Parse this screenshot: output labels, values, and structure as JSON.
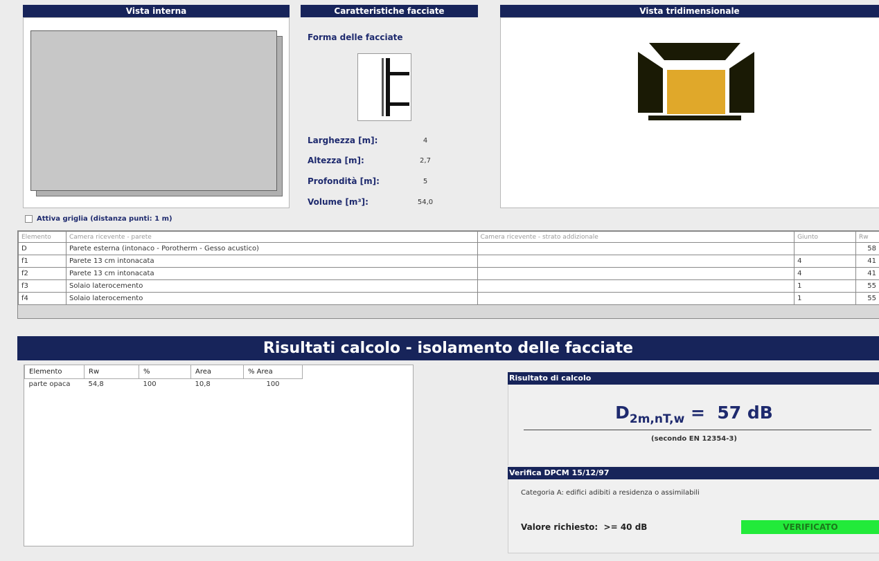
{
  "panels": {
    "internal_view": "Vista interna",
    "facade_features": "Caratteristiche facciate",
    "view_3d": "Vista tridimensionale"
  },
  "facade": {
    "shape_label": "Forma delle facciate",
    "width_label": "Larghezza [m]:",
    "width_value": "4",
    "height_label": "Altezza [m]:",
    "height_value": "2,7",
    "depth_label": "Profondità [m]:",
    "depth_value": "5",
    "volume_label": "Volume [m³]:",
    "volume_value": "54,0"
  },
  "grid": {
    "label": "Attiva griglia (distanza punti: 1 m)"
  },
  "elements_table": {
    "headers": [
      "Elemento",
      "Camera ricevente - parete",
      "Camera ricevente - strato addizionale",
      "Giunto",
      "Rw"
    ],
    "rows": [
      [
        "D",
        "Parete esterna (intonaco - Porotherm - Gesso acustico)",
        "",
        "",
        "58"
      ],
      [
        "f1",
        "Parete 13 cm intonacata",
        "",
        "4",
        "41"
      ],
      [
        "f2",
        "Parete 13 cm intonacata",
        "",
        "4",
        "41"
      ],
      [
        "f3",
        "Solaio laterocemento",
        "",
        "1",
        "55"
      ],
      [
        "f4",
        "Solaio laterocemento",
        "",
        "1",
        "55"
      ]
    ]
  },
  "results": {
    "banner": "Risultati calcolo - isolamento delle facciate",
    "headers": [
      "Elemento",
      "Rw",
      "%",
      "Area",
      "% Area"
    ],
    "rows": [
      [
        "parte opaca",
        "54,8",
        "100",
        "10,8",
        "100"
      ]
    ]
  },
  "calc": {
    "title": "Risultato di calcolo",
    "formula_main": "D",
    "formula_sub": "2m,nT,w",
    "formula_rest": " =  57 dB",
    "note": "(secondo EN 12354-3)"
  },
  "verification": {
    "title": "Verifica DPCM 15/12/97",
    "category": "Categoria A: edifici adibiti a residenza o assimilabili",
    "required": "Valore richiesto:  >= 40 dB",
    "status": "VERIFICATO"
  },
  "colors": {
    "header_navy": "#17245a",
    "status_green": "#22ea3a",
    "room_floor": "#e0a82a"
  }
}
